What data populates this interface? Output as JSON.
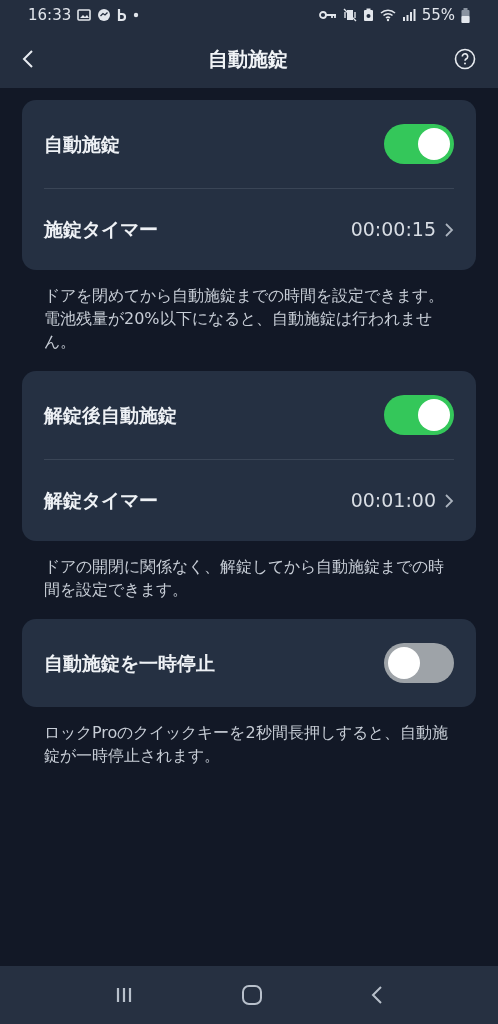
{
  "status_bar": {
    "time": "16:33",
    "battery": "55%"
  },
  "header": {
    "title": "自動施錠"
  },
  "sections": [
    {
      "rows": [
        {
          "kind": "toggle",
          "label": "自動施錠",
          "on": true
        },
        {
          "kind": "timer",
          "label": "施錠タイマー",
          "value": "00:00:15"
        }
      ],
      "notes": [
        "ドアを閉めてから自動施錠までの時間を設定できます。",
        "電池残量が20%以下になると、自動施錠は行われません。"
      ]
    },
    {
      "rows": [
        {
          "kind": "toggle",
          "label": "解錠後自動施錠",
          "on": true
        },
        {
          "kind": "timer",
          "label": "解錠タイマー",
          "value": "00:01:00"
        }
      ],
      "notes": [
        "ドアの開閉に関係なく、解錠してから自動施錠までの時間を設定できます。"
      ]
    },
    {
      "rows": [
        {
          "kind": "toggle",
          "label": "自動施錠を一時停止",
          "on": false
        }
      ],
      "notes": [
        "ロックProのクイックキーを2秒間長押しすると、自動施錠が一時停止されます。"
      ]
    }
  ]
}
